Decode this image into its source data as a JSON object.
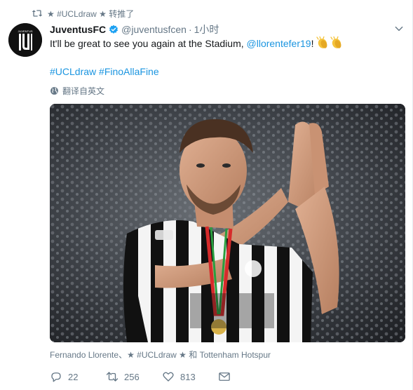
{
  "context": {
    "label": "★ #UCLdraw ★ 转推了",
    "icon": "retweet-icon"
  },
  "author": {
    "name": "JuventusFC",
    "handle": "@juventusfcen",
    "dot": "·",
    "time": "1小时",
    "avatar_icon": "juventus-logo",
    "avatar_small_text": "JUVENTUS",
    "verified_color": "#1da1f2"
  },
  "tweet": {
    "text_main": "It'll be great to see you again at the Stadium, ",
    "mention": "@llorentefer19",
    "text_end": "! ",
    "emoji_icon": "clapping-hands-icon",
    "hashtag_1": "#UCLdraw",
    "hashtag_2": "#FinoAllaFine"
  },
  "translate": {
    "label": "翻译自英文",
    "icon": "globe-icon"
  },
  "media": {
    "icon": "photo-of-player-applauding"
  },
  "tagged": {
    "label": "Fernando Llorente、★ #UCLdraw ★ 和 Tottenham Hotspur"
  },
  "actions": {
    "reply_count": "22",
    "retweet_count": "256",
    "like_count": "813"
  },
  "colors": {
    "link": "#1b95e0",
    "muted": "#657786",
    "text": "#14171a"
  }
}
